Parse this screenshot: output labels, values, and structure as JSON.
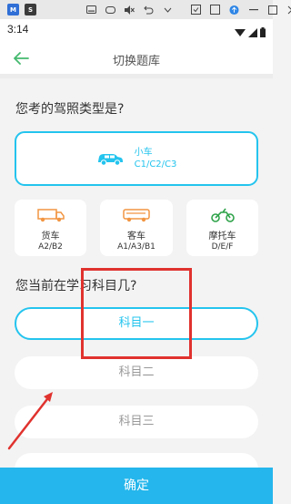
{
  "emulator_bar": {
    "app_icons": [
      {
        "name": "app-icon-1",
        "text": "M"
      },
      {
        "name": "app-icon-2",
        "text": "S"
      }
    ]
  },
  "status_bar": {
    "time": "3:14"
  },
  "header": {
    "title": "切换题库"
  },
  "license_section": {
    "question": "您考的驾照类型是?",
    "selected": {
      "name": "小车",
      "code": "C1/C2/C3"
    },
    "options": [
      {
        "name": "货车",
        "code": "A2/B2"
      },
      {
        "name": "客车",
        "code": "A1/A3/B1"
      },
      {
        "name": "摩托车",
        "code": "D/E/F"
      }
    ]
  },
  "subject_section": {
    "question": "您当前在学习科目几?",
    "options": [
      "科目一",
      "科目二",
      "科目三"
    ]
  },
  "confirm_button": "确定",
  "colors": {
    "accent": "#24c4ee",
    "confirm": "#24b6ec",
    "annotation": "#e0322e",
    "back_arrow": "#46b96f",
    "moto_icon": "#2fa34a",
    "truck_icon": "#f29542"
  }
}
